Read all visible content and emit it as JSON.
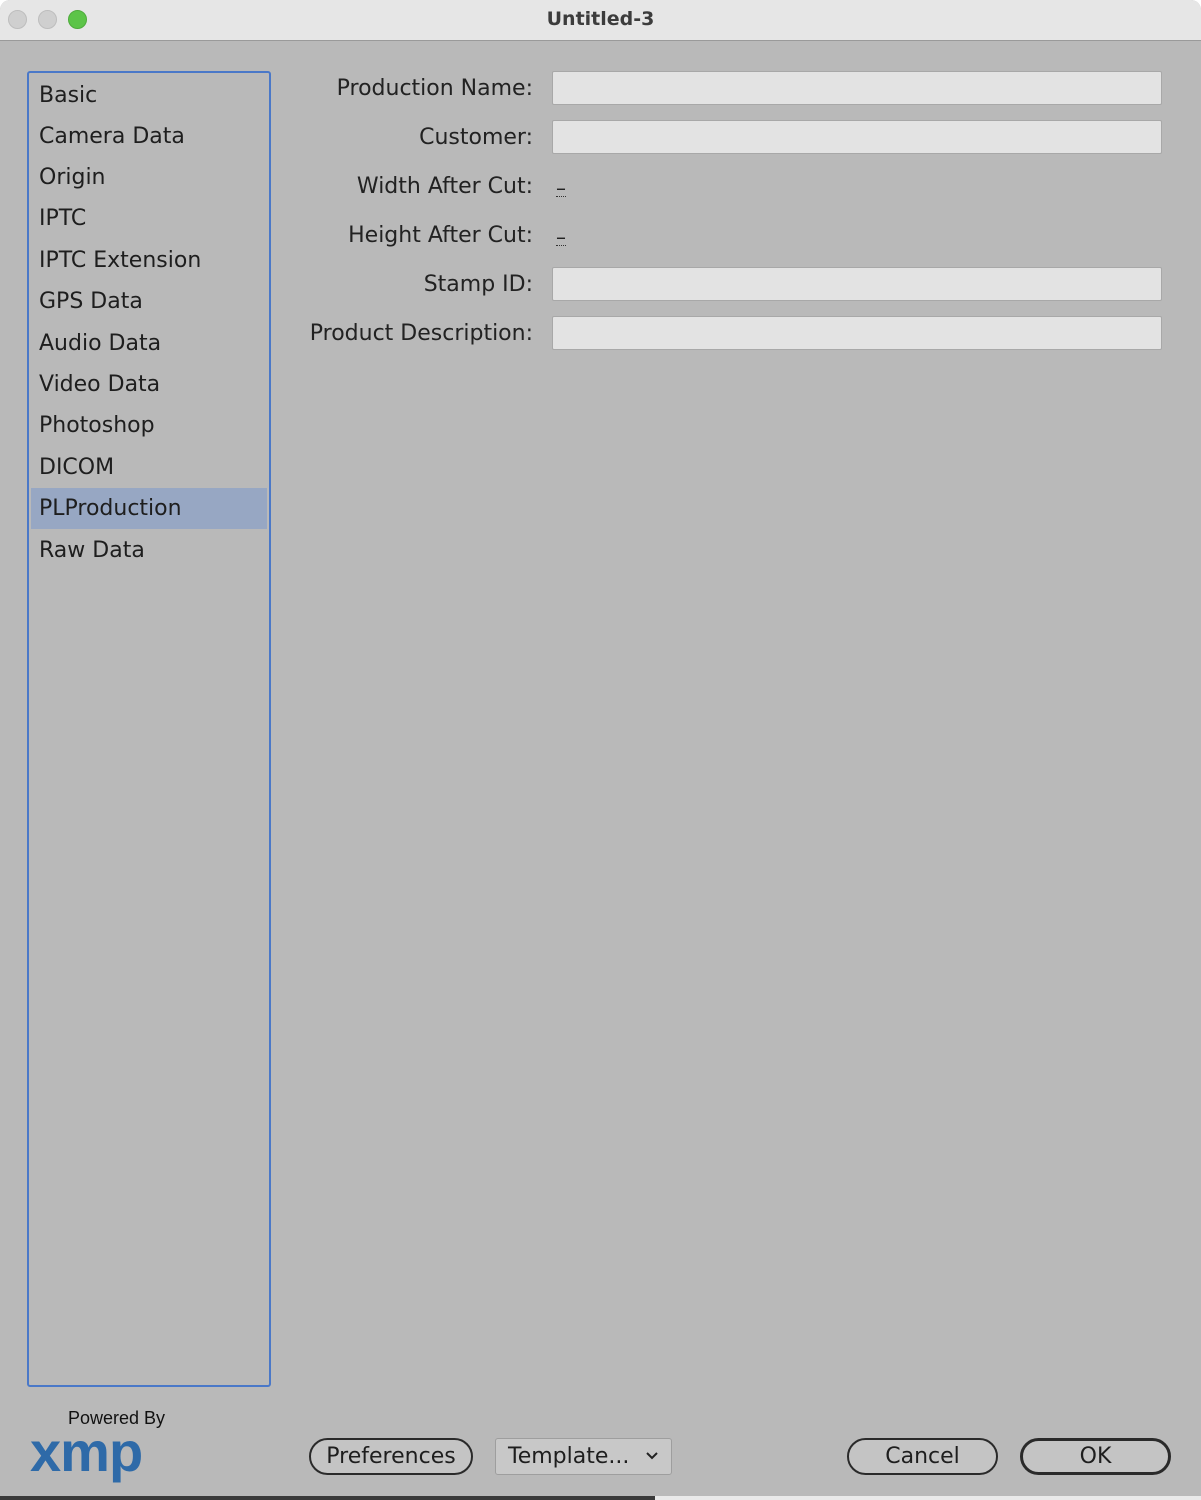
{
  "window": {
    "title": "Untitled-3"
  },
  "sidebar": {
    "items": [
      {
        "label": "Basic"
      },
      {
        "label": "Camera Data"
      },
      {
        "label": "Origin"
      },
      {
        "label": "IPTC"
      },
      {
        "label": "IPTC Extension"
      },
      {
        "label": "GPS Data"
      },
      {
        "label": "Audio Data"
      },
      {
        "label": "Video Data"
      },
      {
        "label": "Photoshop"
      },
      {
        "label": "DICOM"
      },
      {
        "label": "PLProduction",
        "selected": true
      },
      {
        "label": "Raw Data"
      }
    ]
  },
  "form": {
    "production_name": {
      "label": "Production Name:",
      "value": ""
    },
    "customer": {
      "label": "Customer:",
      "value": ""
    },
    "width_after_cut": {
      "label": "Width After Cut:",
      "value": "–"
    },
    "height_after_cut": {
      "label": "Height After Cut:",
      "value": "–"
    },
    "stamp_id": {
      "label": "Stamp ID:",
      "value": ""
    },
    "product_description": {
      "label": "Product Description:",
      "value": ""
    }
  },
  "branding": {
    "powered_by": "Powered By",
    "logo_text": "xmp",
    "logo_color": "#2e6aa8"
  },
  "footer": {
    "preferences_label": "Preferences",
    "template_label": "Template...",
    "cancel_label": "Cancel",
    "ok_label": "OK"
  },
  "colors": {
    "window_bg": "#b9b9b9",
    "selection": "#97a7c3",
    "focus_border": "#4a78c8",
    "zoom_button": "#5cc448"
  }
}
